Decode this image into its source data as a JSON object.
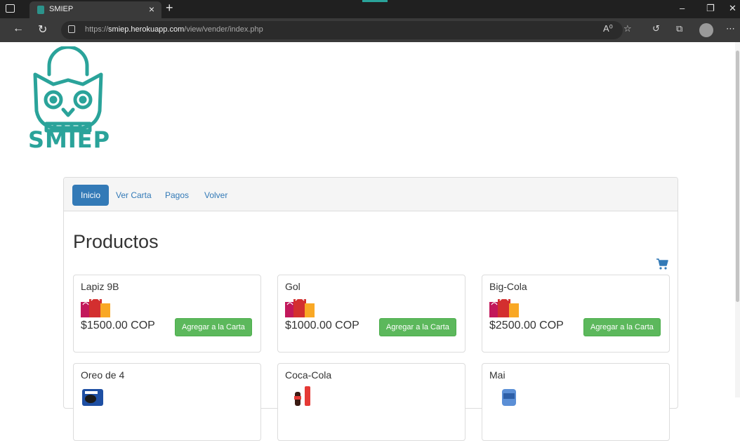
{
  "browser": {
    "tab_title": "SMIEP",
    "tab_close": "×",
    "new_tab": "+",
    "url_protocol": "https://",
    "url_host": "smiep.herokuapp.com",
    "url_path": "/view/vender/index.php",
    "icons": [
      "back-arrow-icon",
      "reload-icon",
      "lock-icon",
      "read-aloud-icon",
      "favorite-icon",
      "extensions-icon",
      "collections-icon",
      "profile-avatar",
      "more-icon"
    ]
  },
  "logo": {
    "word": "SMIEP",
    "color": "#2aa39a"
  },
  "nav": {
    "items": [
      {
        "label": "Inicio",
        "active": true
      },
      {
        "label": "Ver Carta",
        "active": false
      },
      {
        "label": "Pagos",
        "active": false
      },
      {
        "label": "Volver",
        "active": false
      }
    ]
  },
  "page": {
    "title": "Productos"
  },
  "products": [
    {
      "name": "Lapiz 9B",
      "price": "$1500.00 COP",
      "button": "Agregar a la Carta",
      "image": "shopping-bags"
    },
    {
      "name": "Gol",
      "price": "$1000.00 COP",
      "button": "Agregar a la Carta",
      "image": "shopping-bags"
    },
    {
      "name": "Big-Cola",
      "price": "$2500.00 COP",
      "button": "Agregar a la Carta",
      "image": "shopping-bags"
    },
    {
      "name": "Oreo de 4",
      "image": "oreo-pack"
    },
    {
      "name": "Coca-Cola",
      "image": "coca-cola-bottles"
    },
    {
      "name": "Mai",
      "image": "snack-bag"
    }
  ],
  "colors": {
    "primary": "#337ab7",
    "success": "#5cb85c",
    "brand": "#2aa39a"
  }
}
